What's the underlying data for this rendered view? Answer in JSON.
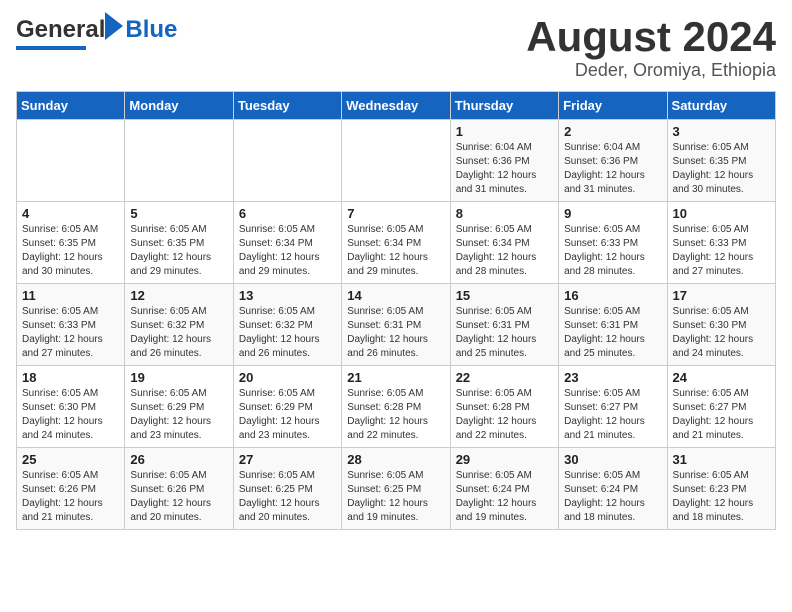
{
  "header": {
    "logo_line1": "General",
    "logo_line2": "Blue",
    "month": "August 2024",
    "location": "Deder, Oromiya, Ethiopia"
  },
  "days_of_week": [
    "Sunday",
    "Monday",
    "Tuesday",
    "Wednesday",
    "Thursday",
    "Friday",
    "Saturday"
  ],
  "weeks": [
    [
      {
        "day": "",
        "info": ""
      },
      {
        "day": "",
        "info": ""
      },
      {
        "day": "",
        "info": ""
      },
      {
        "day": "",
        "info": ""
      },
      {
        "day": "1",
        "info": "Sunrise: 6:04 AM\nSunset: 6:36 PM\nDaylight: 12 hours\nand 31 minutes."
      },
      {
        "day": "2",
        "info": "Sunrise: 6:04 AM\nSunset: 6:36 PM\nDaylight: 12 hours\nand 31 minutes."
      },
      {
        "day": "3",
        "info": "Sunrise: 6:05 AM\nSunset: 6:35 PM\nDaylight: 12 hours\nand 30 minutes."
      }
    ],
    [
      {
        "day": "4",
        "info": "Sunrise: 6:05 AM\nSunset: 6:35 PM\nDaylight: 12 hours\nand 30 minutes."
      },
      {
        "day": "5",
        "info": "Sunrise: 6:05 AM\nSunset: 6:35 PM\nDaylight: 12 hours\nand 29 minutes."
      },
      {
        "day": "6",
        "info": "Sunrise: 6:05 AM\nSunset: 6:34 PM\nDaylight: 12 hours\nand 29 minutes."
      },
      {
        "day": "7",
        "info": "Sunrise: 6:05 AM\nSunset: 6:34 PM\nDaylight: 12 hours\nand 29 minutes."
      },
      {
        "day": "8",
        "info": "Sunrise: 6:05 AM\nSunset: 6:34 PM\nDaylight: 12 hours\nand 28 minutes."
      },
      {
        "day": "9",
        "info": "Sunrise: 6:05 AM\nSunset: 6:33 PM\nDaylight: 12 hours\nand 28 minutes."
      },
      {
        "day": "10",
        "info": "Sunrise: 6:05 AM\nSunset: 6:33 PM\nDaylight: 12 hours\nand 27 minutes."
      }
    ],
    [
      {
        "day": "11",
        "info": "Sunrise: 6:05 AM\nSunset: 6:33 PM\nDaylight: 12 hours\nand 27 minutes."
      },
      {
        "day": "12",
        "info": "Sunrise: 6:05 AM\nSunset: 6:32 PM\nDaylight: 12 hours\nand 26 minutes."
      },
      {
        "day": "13",
        "info": "Sunrise: 6:05 AM\nSunset: 6:32 PM\nDaylight: 12 hours\nand 26 minutes."
      },
      {
        "day": "14",
        "info": "Sunrise: 6:05 AM\nSunset: 6:31 PM\nDaylight: 12 hours\nand 26 minutes."
      },
      {
        "day": "15",
        "info": "Sunrise: 6:05 AM\nSunset: 6:31 PM\nDaylight: 12 hours\nand 25 minutes."
      },
      {
        "day": "16",
        "info": "Sunrise: 6:05 AM\nSunset: 6:31 PM\nDaylight: 12 hours\nand 25 minutes."
      },
      {
        "day": "17",
        "info": "Sunrise: 6:05 AM\nSunset: 6:30 PM\nDaylight: 12 hours\nand 24 minutes."
      }
    ],
    [
      {
        "day": "18",
        "info": "Sunrise: 6:05 AM\nSunset: 6:30 PM\nDaylight: 12 hours\nand 24 minutes."
      },
      {
        "day": "19",
        "info": "Sunrise: 6:05 AM\nSunset: 6:29 PM\nDaylight: 12 hours\nand 23 minutes."
      },
      {
        "day": "20",
        "info": "Sunrise: 6:05 AM\nSunset: 6:29 PM\nDaylight: 12 hours\nand 23 minutes."
      },
      {
        "day": "21",
        "info": "Sunrise: 6:05 AM\nSunset: 6:28 PM\nDaylight: 12 hours\nand 22 minutes."
      },
      {
        "day": "22",
        "info": "Sunrise: 6:05 AM\nSunset: 6:28 PM\nDaylight: 12 hours\nand 22 minutes."
      },
      {
        "day": "23",
        "info": "Sunrise: 6:05 AM\nSunset: 6:27 PM\nDaylight: 12 hours\nand 21 minutes."
      },
      {
        "day": "24",
        "info": "Sunrise: 6:05 AM\nSunset: 6:27 PM\nDaylight: 12 hours\nand 21 minutes."
      }
    ],
    [
      {
        "day": "25",
        "info": "Sunrise: 6:05 AM\nSunset: 6:26 PM\nDaylight: 12 hours\nand 21 minutes."
      },
      {
        "day": "26",
        "info": "Sunrise: 6:05 AM\nSunset: 6:26 PM\nDaylight: 12 hours\nand 20 minutes."
      },
      {
        "day": "27",
        "info": "Sunrise: 6:05 AM\nSunset: 6:25 PM\nDaylight: 12 hours\nand 20 minutes."
      },
      {
        "day": "28",
        "info": "Sunrise: 6:05 AM\nSunset: 6:25 PM\nDaylight: 12 hours\nand 19 minutes."
      },
      {
        "day": "29",
        "info": "Sunrise: 6:05 AM\nSunset: 6:24 PM\nDaylight: 12 hours\nand 19 minutes."
      },
      {
        "day": "30",
        "info": "Sunrise: 6:05 AM\nSunset: 6:24 PM\nDaylight: 12 hours\nand 18 minutes."
      },
      {
        "day": "31",
        "info": "Sunrise: 6:05 AM\nSunset: 6:23 PM\nDaylight: 12 hours\nand 18 minutes."
      }
    ]
  ]
}
